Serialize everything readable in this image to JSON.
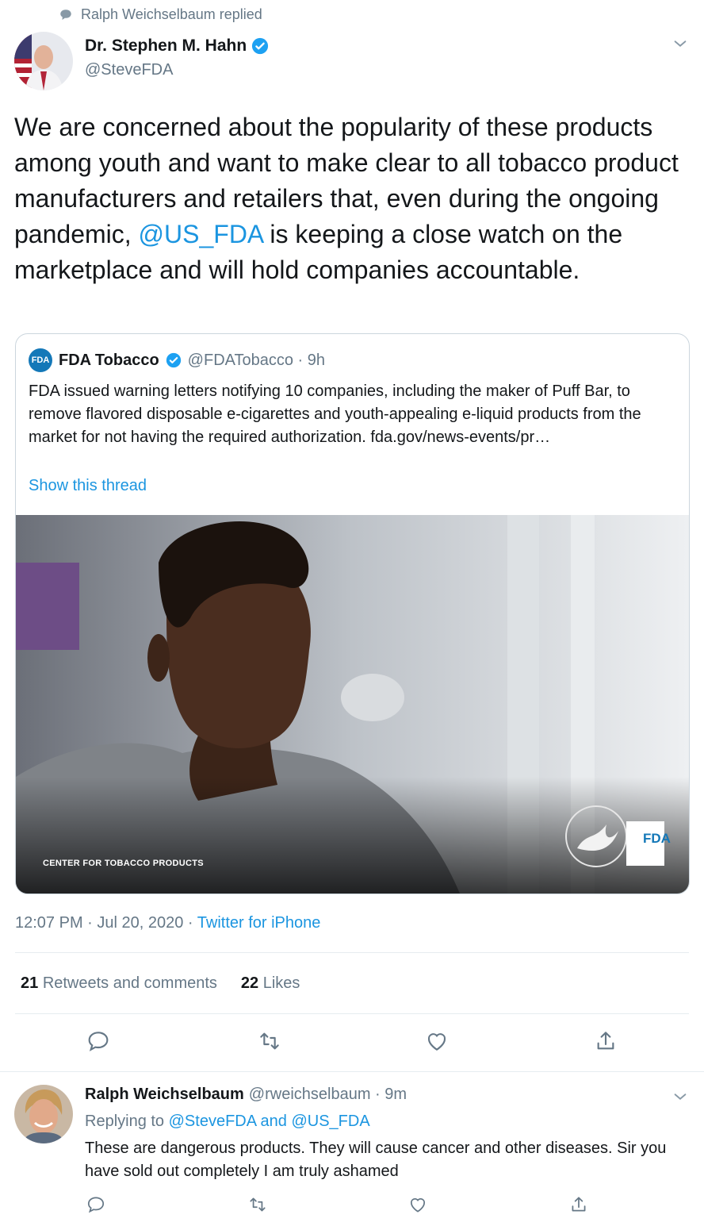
{
  "context": {
    "text": "Ralph Weichselbaum replied"
  },
  "tweet": {
    "author_name": "Dr. Stephen M. Hahn",
    "author_handle": "@SteveFDA",
    "text_before": "We are concerned about the popularity of these products among youth and want to make clear to all tobacco product manufacturers and retailers that, even during the ongoing pandemic, ",
    "text_mention": "@US_FDA",
    "text_after": " is keeping a close watch on the marketplace and will hold companies accountable.",
    "time": "12:07 PM · Jul 20, 2020 · ",
    "source": "Twitter for iPhone",
    "retweets_count": "21",
    "retweets_label": "Retweets and comments",
    "likes_count": "22",
    "likes_label": "Likes"
  },
  "quote": {
    "logo_text": "FDA",
    "author_name": "FDA Tobacco",
    "author_handle_time": "@FDATobacco · 9h",
    "text": "FDA issued warning letters notifying 10 companies, including the maker of Puff Bar, to remove flavored disposable e-cigarettes and youth-appealing e-liquid products from the market for not having the required authorization. fda.gov/news-events/pr…",
    "show_thread": "Show this thread",
    "image_caption": "CENTER FOR TOBACCO PRODUCTS",
    "image_badge": "FDA"
  },
  "reply": {
    "author_name": "Ralph Weichselbaum",
    "author_handle_time": "@rweichselbaum · 9m",
    "replying_prefix": "Replying to ",
    "replying_targets": "@SteveFDA and @US_FDA",
    "text": "These are dangerous products. They will cause cancer and other diseases. Sir you have sold out completely I am truly ashamed"
  },
  "colors": {
    "accent": "#1b95e0",
    "muted": "#657786",
    "text": "#14171a"
  },
  "icons": [
    "comment-icon",
    "retweet-icon",
    "like-icon",
    "share-icon",
    "verified-badge-icon",
    "chevron-down-icon"
  ]
}
